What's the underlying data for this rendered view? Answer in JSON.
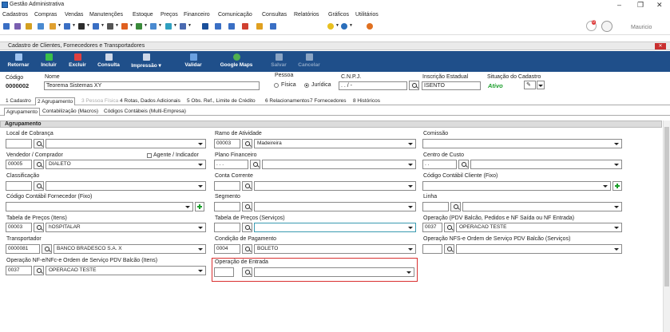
{
  "app": {
    "title": "Gestão Administrativa",
    "user": "Mauricio",
    "notif_count": "0"
  },
  "menu": [
    "Cadastros",
    "Compras",
    "Vendas",
    "Manutenções",
    "Estoque",
    "Preços",
    "Financeiro",
    "Comunicação",
    "Consultas",
    "Relatórios",
    "Gráficos",
    "Utilitários"
  ],
  "window": {
    "title": "Cadastro de Clientes, Fornecedores e Transportadores"
  },
  "ribbon": {
    "retornar": "Retornar",
    "incluir": "Incluir",
    "excluir": "Excluir",
    "consulta": "Consulta",
    "impressao": "Impressão",
    "validar": "Validar",
    "google_maps": "Google Maps",
    "salvar": "Salvar",
    "cancelar": "Cancelar"
  },
  "header": {
    "codigo_label": "Código",
    "codigo": "0000002",
    "nome_label": "Nome",
    "nome": "Teorema Sistemas XY",
    "pessoa_label": "Pessoa",
    "fisica": "Física",
    "juridica": "Jurídica",
    "cnpj_label": "C.N.P.J.",
    "cnpj": ". . / -",
    "ie_label": "Inscrição Estadual",
    "ie": "ISENTO",
    "situacao_label": "Situação do Cadastro",
    "situacao": "Ativo"
  },
  "tabs": [
    "1 Cadastro",
    "2 Agrupamento",
    "3 Pessoa Física",
    "4 Rotas, Dados Adicionais",
    "5 Obs. Ref., Limite de Crédito",
    "6 Relacionamentos",
    "7 Fornecedores",
    "8 Históricos"
  ],
  "subtabs": [
    "Agrupamento",
    "Contabilização (Macros)",
    "Códigos Contábeis (Multi-Empresa)"
  ],
  "group": {
    "title": "Agrupamento"
  },
  "fields": {
    "local_cobranca": {
      "label": "Local de Cobrança",
      "code": "",
      "value": ""
    },
    "ramo_atividade": {
      "label": "Ramo de Atividade",
      "code": "00003",
      "value": "Madeireira"
    },
    "comissao": {
      "label": "Comissão",
      "value": ""
    },
    "vendedor": {
      "label": "Vendedor / Comprador",
      "code": "00005",
      "value": "DIALETO",
      "agente_label": "Agente / Indicador"
    },
    "plano_financeiro": {
      "label": "Plano Financeiro",
      "code": ". . .",
      "value": ""
    },
    "centro_custo": {
      "label": "Centro de Custo",
      "code": ". .",
      "value": ""
    },
    "classificacao": {
      "label": "Classificação",
      "code": "",
      "value": ""
    },
    "conta_corrente": {
      "label": "Conta Corrente",
      "code": "",
      "value": ""
    },
    "cod_contabil_cliente": {
      "label": "Código Contábil Cliente (Fixo)",
      "value": ""
    },
    "cod_contabil_fornecedor": {
      "label": "Código Contábil Fornecedor (Fixo)",
      "value": ""
    },
    "segmento": {
      "label": "Segmento",
      "code": "",
      "value": ""
    },
    "linha": {
      "label": "Linha",
      "code": "",
      "value": ""
    },
    "tabela_itens": {
      "label": "Tabela de Preços (Itens)",
      "code": "00003",
      "value": "hOSPITALAR"
    },
    "tabela_servicos": {
      "label": "Tabela de Preços (Serviços)",
      "code": "",
      "value": ""
    },
    "operacao_pdv": {
      "label": "Operação (PDV Balcão, Pedidos e NF Saída ou NF Entrada)",
      "code": "0037",
      "value": "OPERACAO TESTE"
    },
    "transportador": {
      "label": "Transportador",
      "code": "0000081",
      "value": "BANCO BRADESCO S.A. X"
    },
    "condicao_pagamento": {
      "label": "Condição de Pagamento",
      "code": "0004",
      "value": "BOLETO"
    },
    "operacao_nfse": {
      "label": "Operação NFS-e Ordem de Serviço PDV Balcão (Serviços)",
      "code": "",
      "value": ""
    },
    "operacao_nfe": {
      "label": "Operação NF-e/NFc-e Ordem de Serviço PDV Balcão (Itens)",
      "code": "0037",
      "value": "OPERACAO TESTE"
    },
    "operacao_entrada": {
      "label": "Operação de Entrada",
      "code": "",
      "value": ""
    }
  }
}
